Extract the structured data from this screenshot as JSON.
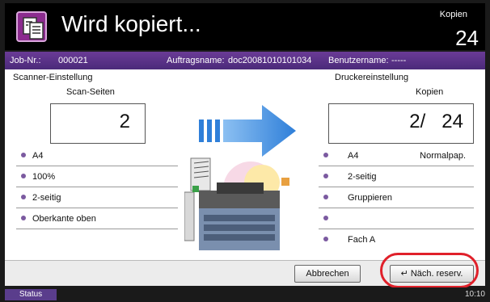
{
  "header": {
    "title": "Wird kopiert...",
    "copies_label": "Kopien",
    "copies_count": "24",
    "icon": "copy-document-icon"
  },
  "jobbar": {
    "job_no_label": "Job-Nr.:",
    "job_no": "000021",
    "job_name_label": "Auftragsname:",
    "job_name": "doc20081010101034",
    "user_label": "Benutzername:",
    "user": "-----"
  },
  "scanner": {
    "heading": "Scanner-Einstellung",
    "pages_label": "Scan-Seiten",
    "pages_value": "2",
    "settings": [
      "A4",
      "100%",
      "2-seitig",
      "Oberkante oben"
    ]
  },
  "printer": {
    "heading": "Druckereinstellung",
    "copies_label": "Kopien",
    "copies_value": "2/   24",
    "settings": [
      {
        "label": "A4",
        "extra": "Normalpap."
      },
      {
        "label": "2-seitig",
        "extra": ""
      },
      {
        "label": "Gruppieren",
        "extra": ""
      },
      {
        "label": "",
        "extra": ""
      },
      {
        "label": "Fach A",
        "extra": ""
      }
    ]
  },
  "buttons": {
    "cancel": "Abbrechen",
    "reserve_next": "Näch. reserv."
  },
  "statusbar": {
    "status": "Status",
    "time": "10:10"
  },
  "colors": {
    "accent": "#5a3d8c",
    "arrow": "#2f7fd9",
    "highlight": "#e0202a"
  }
}
